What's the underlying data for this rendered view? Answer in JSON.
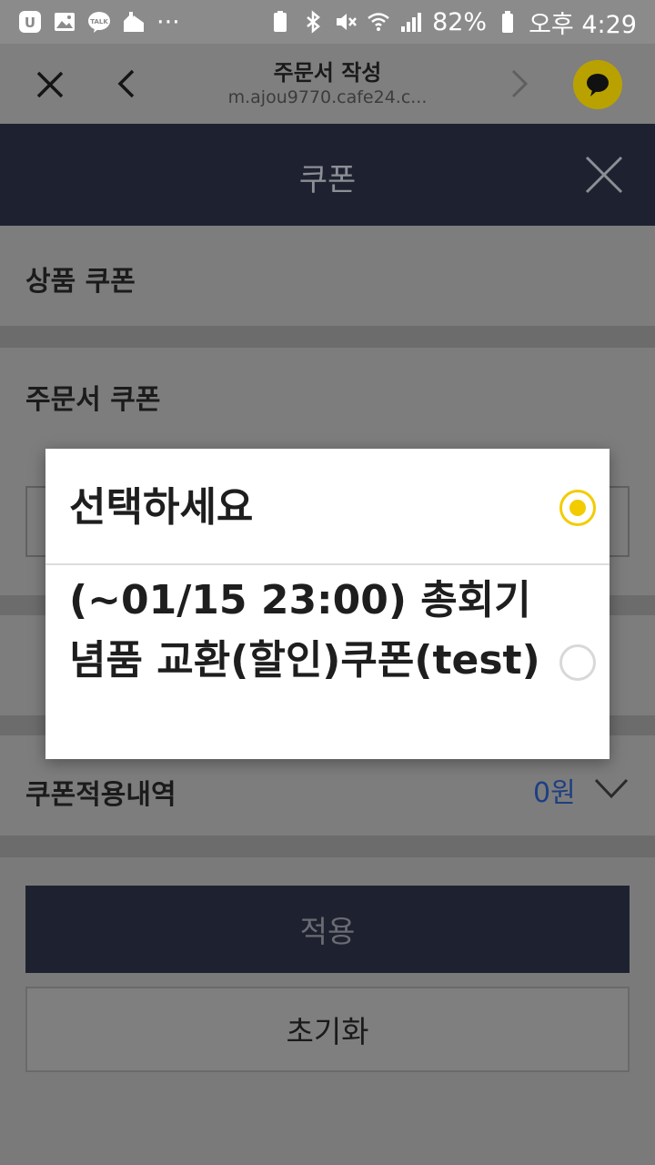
{
  "status_bar": {
    "battery": "82%",
    "time": "오후 4:29",
    "notification_dots": "···"
  },
  "browser": {
    "title": "주문서 작성",
    "url": "m.ajou9770.cafe24.c..."
  },
  "coupon_panel": {
    "title": "쿠폰",
    "product_coupon_label": "상품 쿠폰",
    "order_coupon_label": "주문서 쿠폰",
    "summary_label": "쿠폰적용내역",
    "summary_value": "0원",
    "apply_label": "적용",
    "reset_label": "초기화"
  },
  "dialog": {
    "options": [
      {
        "label": "선택하세요",
        "selected": true
      },
      {
        "label": "(~01/15 23:00) 총회기념품 교환(할인)쿠폰(test)",
        "selected": false
      }
    ]
  },
  "colors": {
    "accent_yellow": "#f2cc00",
    "navy": "#1e2230",
    "summary_blue": "#1e3f82"
  }
}
